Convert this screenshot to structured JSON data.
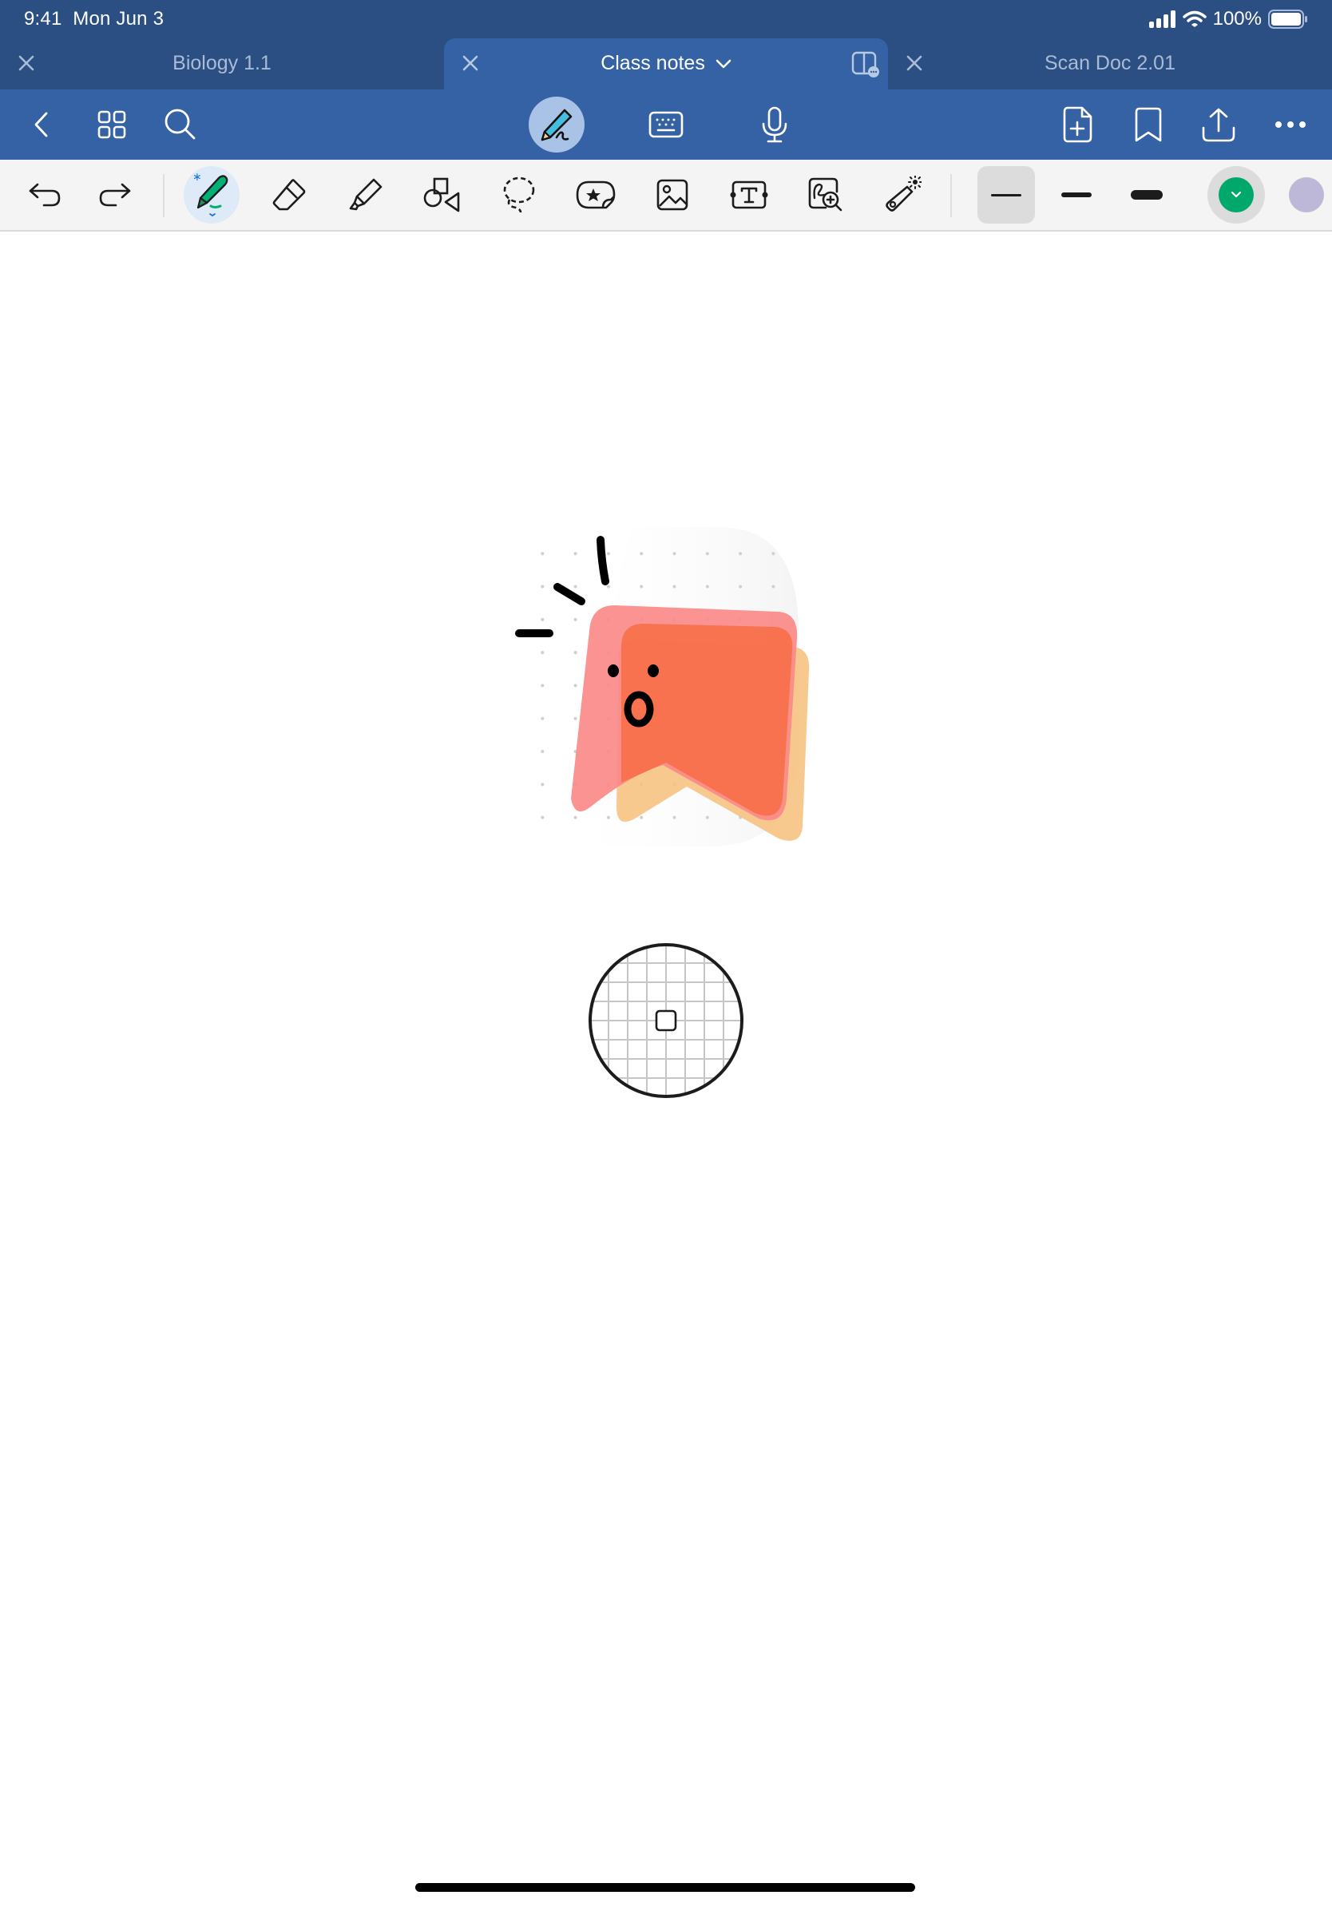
{
  "status_bar": {
    "time": "9:41",
    "date": "Mon Jun 3",
    "battery": "100%",
    "icons": [
      "cellular-signal-icon",
      "wifi-icon",
      "battery-icon"
    ]
  },
  "tabs": [
    {
      "title": "Biology 1.1",
      "active": false
    },
    {
      "title": "Class notes",
      "active": true
    },
    {
      "title": "Scan Doc 2.01",
      "active": false
    }
  ],
  "nav_toolbar": {
    "left": [
      "back-icon",
      "grid-view-icon",
      "search-icon"
    ],
    "modes": [
      "handwriting-mode-icon",
      "keyboard-mode-icon",
      "microphone-icon"
    ],
    "active_mode": "handwriting",
    "right": [
      "add-page-icon",
      "bookmark-icon",
      "share-icon",
      "more-icon"
    ]
  },
  "drawing_toolbar": {
    "tools": [
      "undo",
      "redo",
      "pen",
      "eraser",
      "highlighter",
      "shapes",
      "lasso",
      "sticker",
      "image",
      "text-box",
      "zoom-window",
      "laser-pointer"
    ],
    "selected_tool": "pen",
    "stroke_widths": [
      "thin",
      "medium",
      "thick"
    ],
    "selected_stroke": "thin",
    "colors": {
      "selected": "#00a86b",
      "alternate": "#bdb8d8"
    }
  },
  "canvas": {
    "sticker": "surprised-bookmark-sticker",
    "cursor": "magnifier-loupe"
  }
}
